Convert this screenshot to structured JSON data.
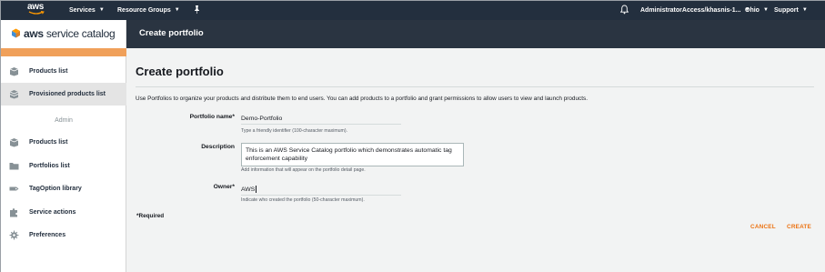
{
  "topbar": {
    "logo_text": "aws",
    "services": "Services",
    "resource_groups": "Resource Groups",
    "account": "AdministratorAccess/khasnis-1...",
    "region": "Ohio",
    "support": "Support"
  },
  "brand": {
    "name_bold": "aws",
    "name_rest": " service catalog"
  },
  "header": {
    "title": "Create portfolio"
  },
  "sidebar": {
    "items": [
      {
        "label": "Products list",
        "icon": "box-icon"
      },
      {
        "label": "Provisioned products list",
        "icon": "stacked-box-icon",
        "active": true
      }
    ],
    "admin_heading": "Admin",
    "admin_items": [
      {
        "label": "Products list",
        "icon": "box-icon"
      },
      {
        "label": "Portfolios list",
        "icon": "folder-icon"
      },
      {
        "label": "TagOption library",
        "icon": "tag-icon"
      },
      {
        "label": "Service actions",
        "icon": "puzzle-icon"
      },
      {
        "label": "Preferences",
        "icon": "gear-icon"
      }
    ]
  },
  "form": {
    "page_title": "Create portfolio",
    "intro": "Use Portfolios to organize your products and distribute them to end users. You can add products to a portfolio and grant permissions to allow users to view and launch products.",
    "name_label": "Portfolio name*",
    "name_value": "Demo-Portfolio",
    "name_hint": "Type a friendly identifier (100-character maximum).",
    "desc_label": "Description",
    "desc_value": "This is an AWS Service Catalog portfolio which demonstrates automatic tag enforcement capability",
    "desc_hint": "Add information that will appear on the portfolio detail page.",
    "owner_label": "Owner*",
    "owner_value": "AWS",
    "owner_hint": "Indicate who created the portfolio (50-character maximum).",
    "required_note": "*Required",
    "cancel": "CANCEL",
    "create": "CREATE"
  },
  "colors": {
    "nav_bg": "#232f3e",
    "header_bg": "#2a3441",
    "accent": "#ec7211",
    "sidebar_stripe": "#f0a05a",
    "main_bg": "#f2f3f3"
  }
}
